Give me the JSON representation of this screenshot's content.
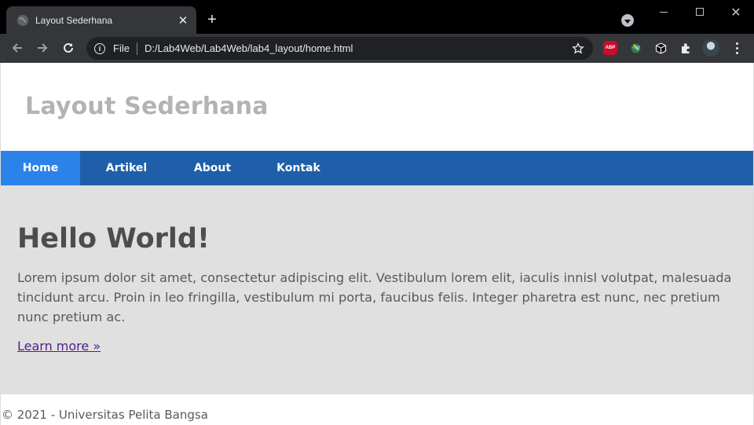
{
  "browser": {
    "tab": {
      "title": "Layout Sederhana",
      "favicon": "globe-icon",
      "close": "✕"
    },
    "new_tab": "+",
    "address_bar": {
      "scheme_label": "File",
      "url": "D:/Lab4Web/Lab4Web/lab4_layout/home.html",
      "info_icon": "i"
    },
    "extensions": {
      "abp_label": "ABP"
    }
  },
  "site": {
    "title": "Layout Sederhana",
    "nav": [
      {
        "label": "Home",
        "active": true
      },
      {
        "label": "Artikel",
        "active": false
      },
      {
        "label": "About",
        "active": false
      },
      {
        "label": "Kontak",
        "active": false
      }
    ],
    "hero": {
      "heading": "Hello World!",
      "paragraph": "Lorem ipsum dolor sit amet, consectetur adipiscing elit. Vestibulum lorem elit, iaculis innisl volutpat, malesuada tincidunt arcu. Proin in leo fringilla, vestibulum mi porta, faucibus felis. Integer pharetra est nunc, nec pretium nunc pretium ac.",
      "link": "Learn more »"
    },
    "footer": "© 2021 - Universitas Pelita Bangsa"
  },
  "colors": {
    "nav_bg": "#1f5faa",
    "nav_active": "#2b83ea",
    "hero_bg": "#e0e0e0",
    "title_color": "#b3b3b3",
    "link_color": "#551a8b"
  }
}
